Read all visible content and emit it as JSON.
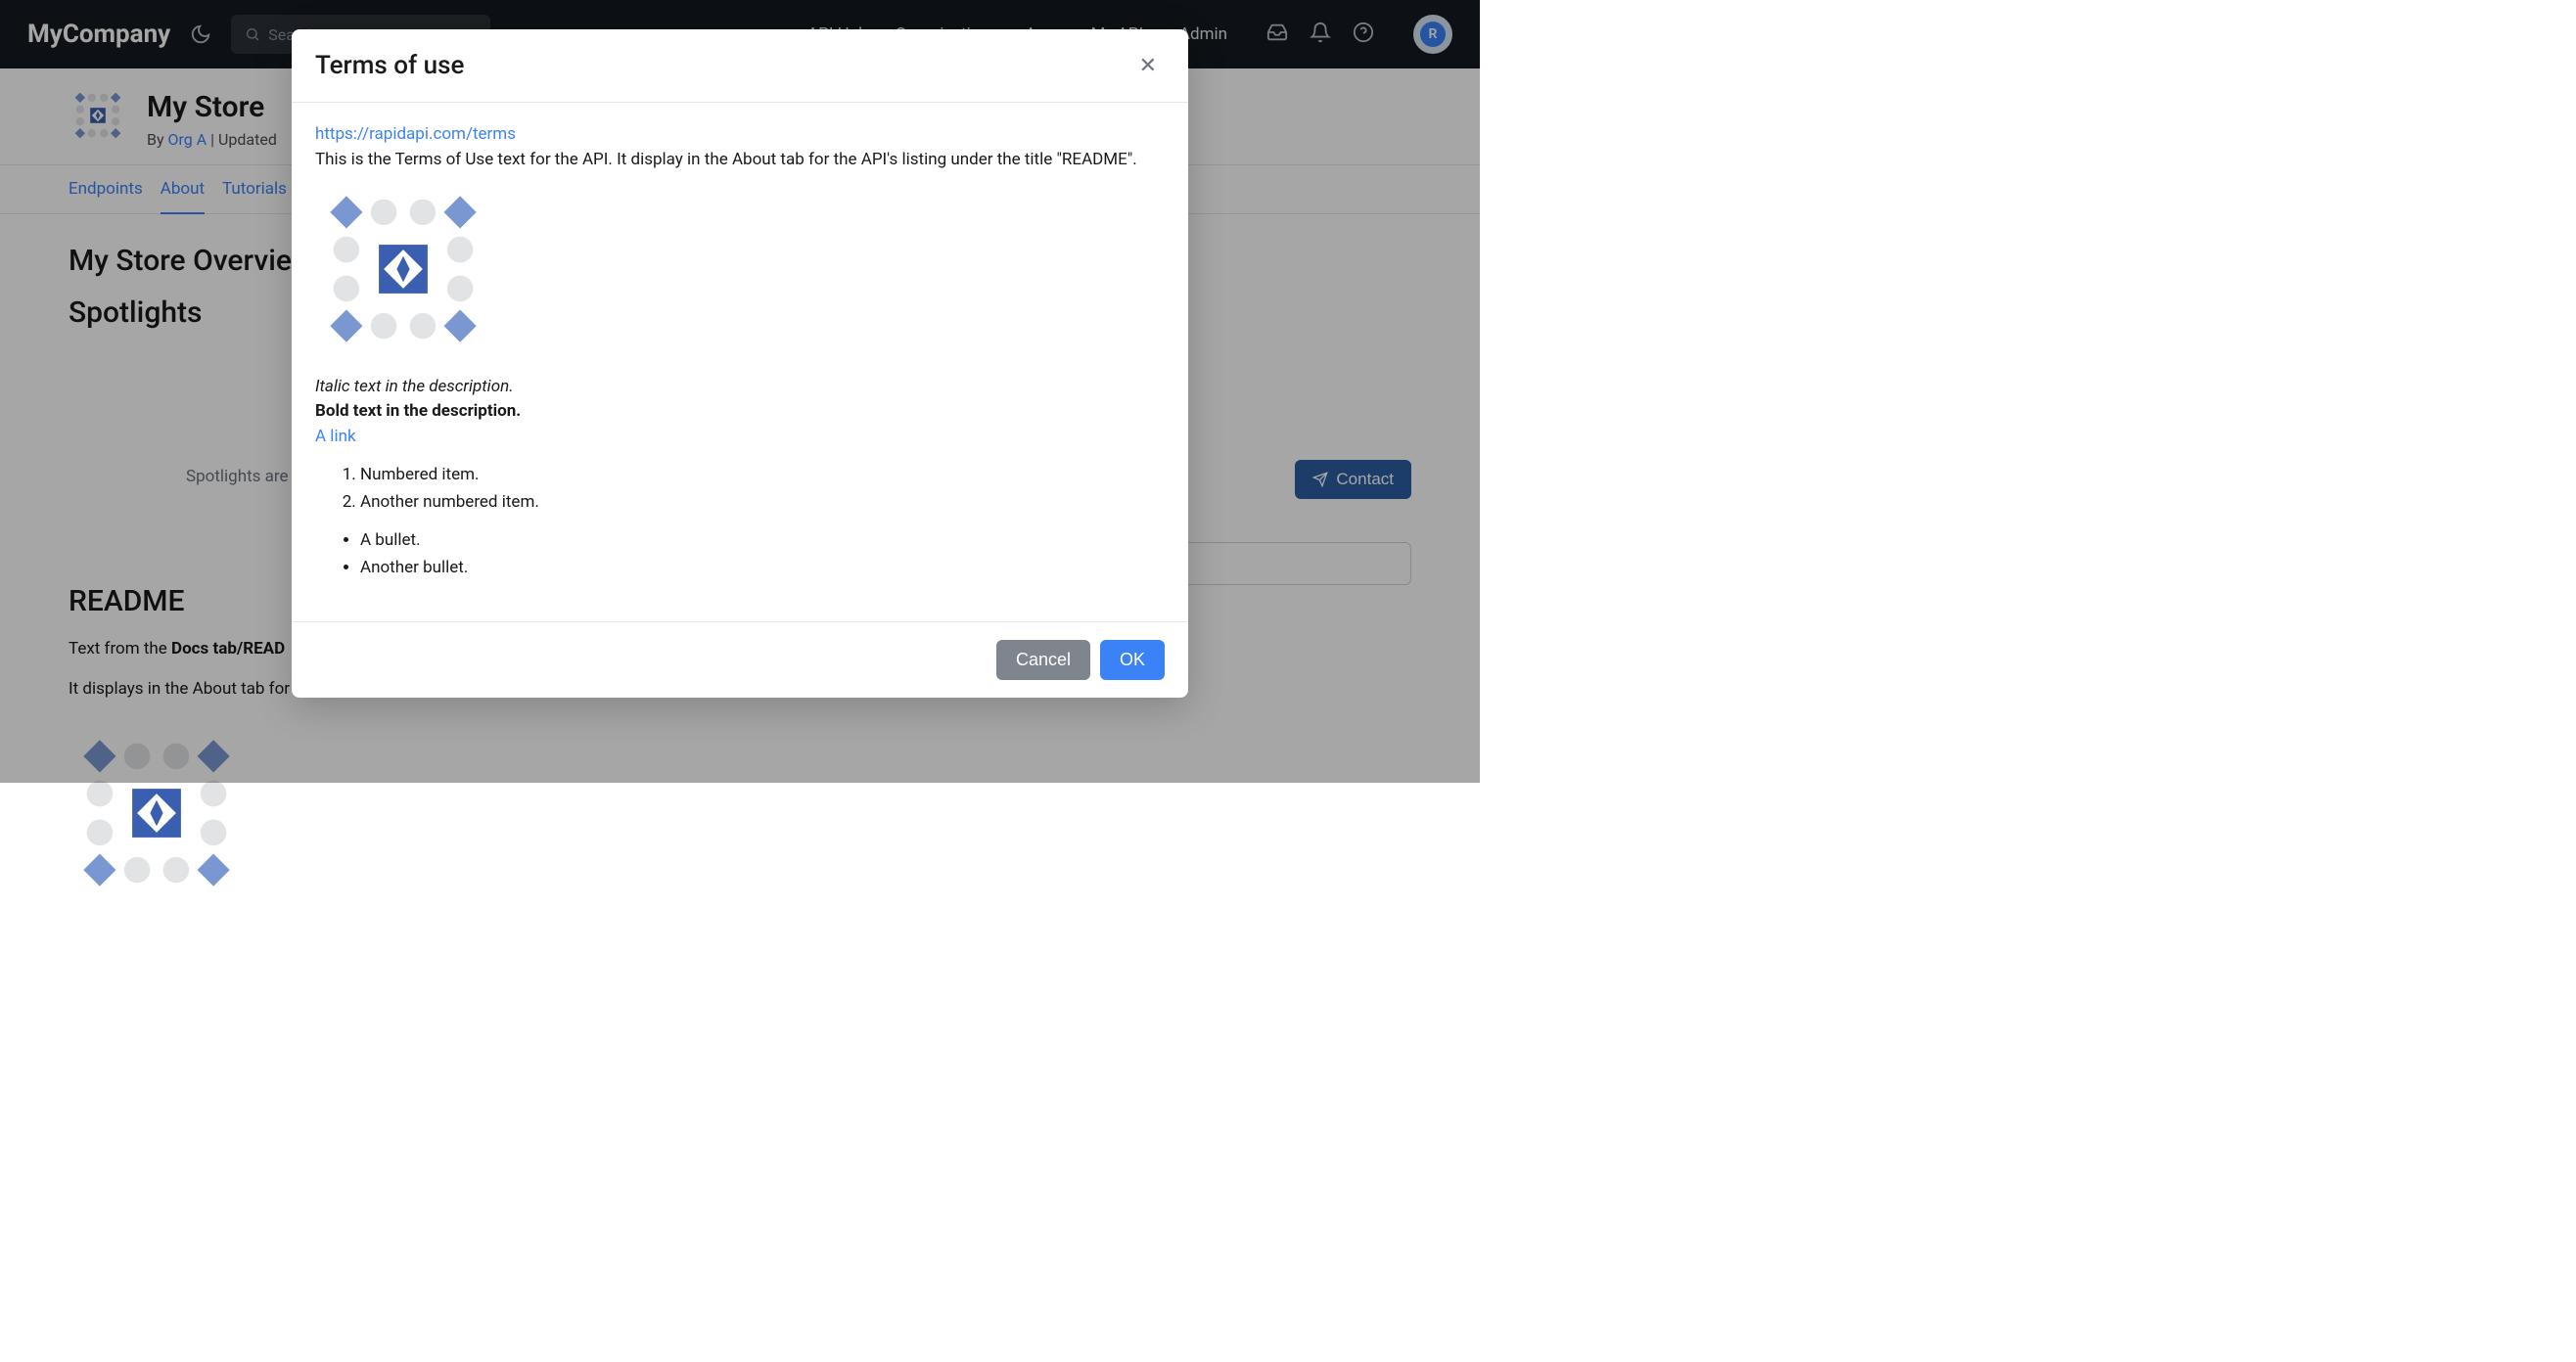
{
  "header": {
    "brand": "MyCompany",
    "search_placeholder": "Search APIs",
    "nav": [
      "API Hub",
      "Organizations",
      "Apps",
      "My APIs",
      "Admin"
    ]
  },
  "page": {
    "title": "My Store",
    "by_prefix": "By ",
    "org": "Org A",
    "updated_sep": " | ",
    "updated_label": "Updated"
  },
  "tabs": [
    "Endpoints",
    "About",
    "Tutorials"
  ],
  "content": {
    "overview_heading": "My Store Overview",
    "spotlights_heading": "Spotlights",
    "spotlights_msg": "Spotlights are",
    "readme_heading": "README",
    "readme_p1_prefix": "Text from the ",
    "readme_p1_bold": "Docs tab/READ",
    "readme_p2": "It displays in the About tab for the API's listing under the title \"README\" (below any Long Description content."
  },
  "contact": {
    "label": "Contact"
  },
  "modal": {
    "title": "Terms of use",
    "terms_url": "https://rapidapi.com/terms",
    "intro": "This is the Terms of Use text for the API. It display in the About tab for the API's listing under the title \"README\".",
    "italic_text": "Italic text in the description.",
    "bold_text": "Bold text in the description.",
    "link_text": "A link",
    "ol": [
      "Numbered item.",
      "Another numbered item."
    ],
    "ul": [
      "A bullet.",
      "Another bullet."
    ],
    "cancel": "Cancel",
    "ok": "OK"
  }
}
